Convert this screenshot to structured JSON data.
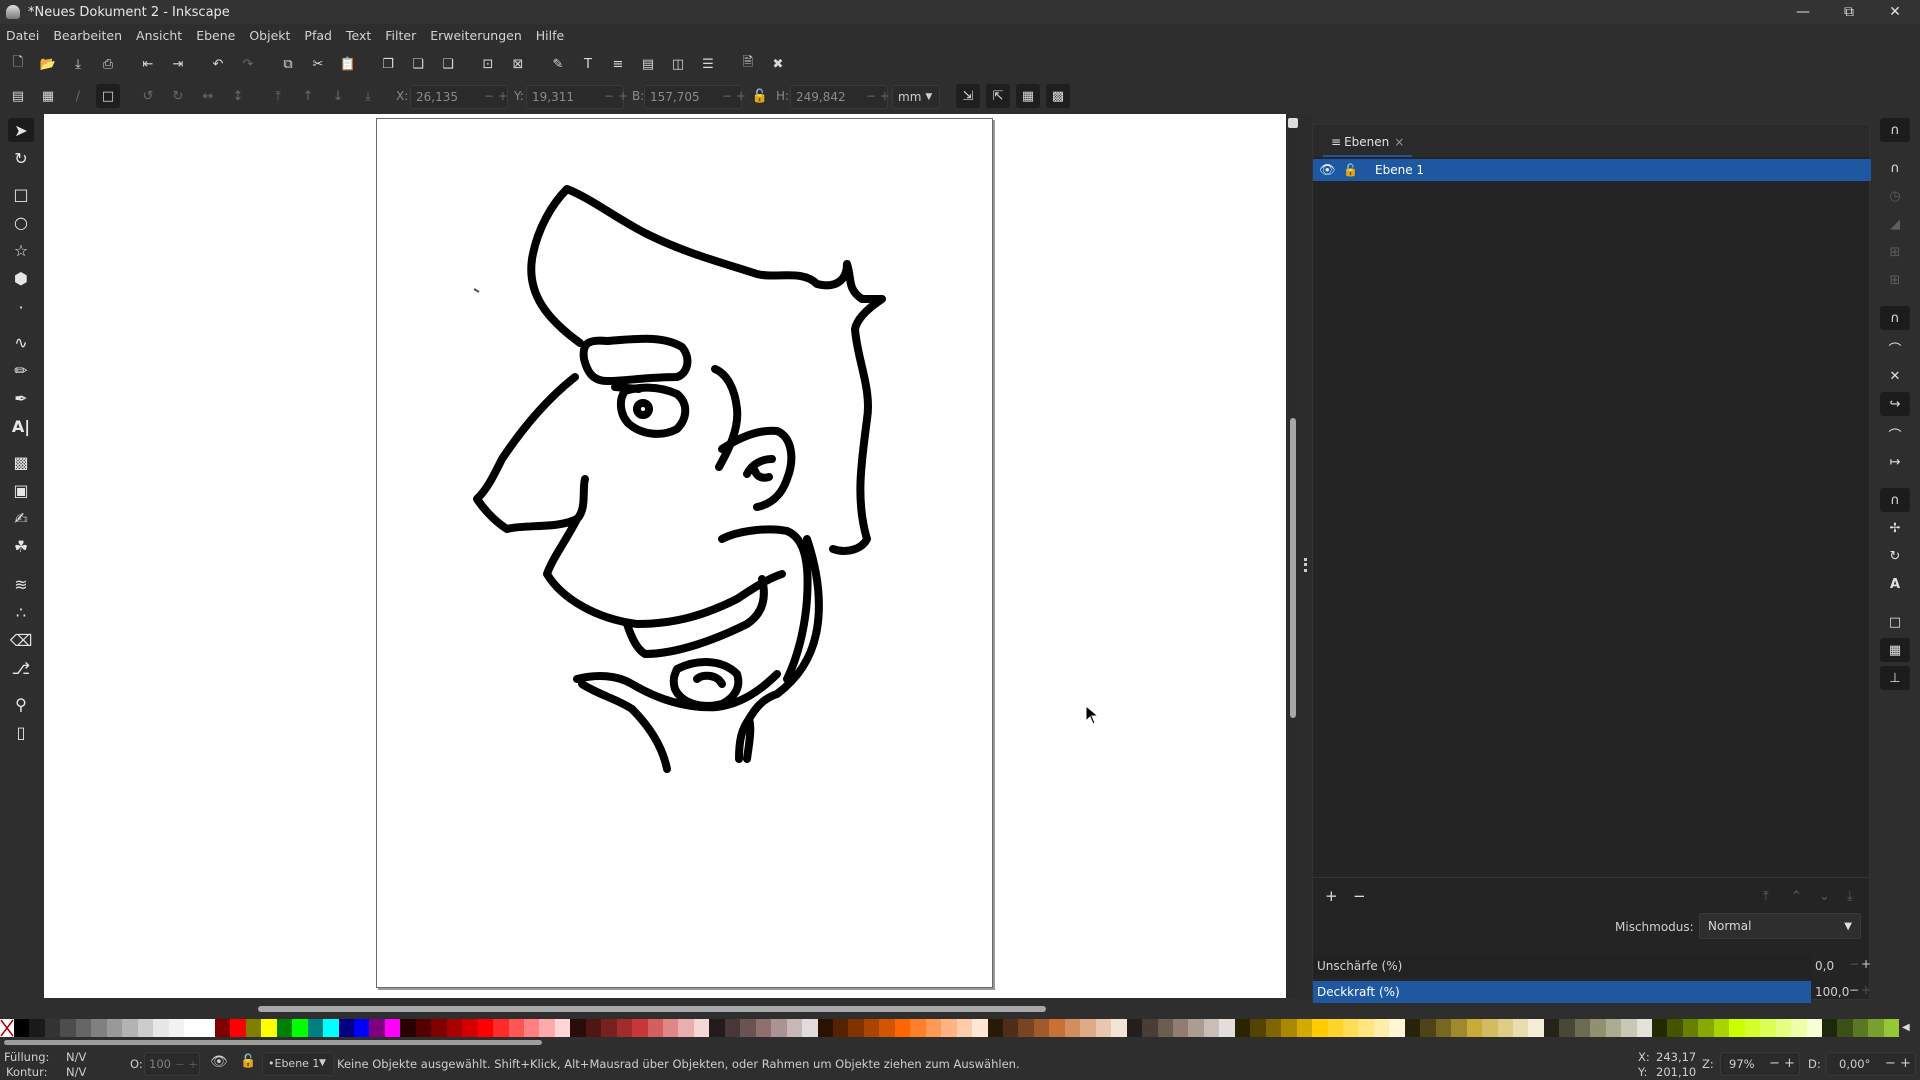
{
  "window": {
    "title": "*Neues Dokument 2 - Inkscape",
    "minimize_icon": "minimize-icon",
    "maximize_icon": "restore-icon",
    "close_icon": "close-icon"
  },
  "menu": [
    "Datei",
    "Bearbeiten",
    "Ansicht",
    "Ebene",
    "Objekt",
    "Pfad",
    "Text",
    "Filter",
    "Erweiterungen",
    "Hilfe"
  ],
  "commands_toolbar": [
    "new-document-icon",
    "open-icon",
    "save-icon",
    "print-icon",
    "import-icon",
    "export-icon",
    "undo-icon",
    "redo-icon",
    "copy-icon",
    "cut-icon",
    "paste-icon",
    "duplicate-icon",
    "clone-icon",
    "unlink-clone-icon",
    "group-icon",
    "ungroup-icon",
    "fill-stroke-icon",
    "text-font-icon",
    "layers-icon",
    "xml-editor-icon",
    "objects-icon",
    "align-distribute-icon",
    "document-properties-icon",
    "preferences-icon"
  ],
  "select_toolbar": {
    "icons": [
      "select-all-icon",
      "select-all-layers-icon",
      "deselect-icon",
      "touch-select-icon",
      "rotate-ccw-icon",
      "rotate-cw-icon",
      "flip-horizontal-icon",
      "flip-vertical-icon",
      "raise-to-top-icon",
      "raise-icon",
      "lower-icon",
      "lower-to-bottom-icon"
    ],
    "x_label": "X:",
    "x_value": "26,135",
    "y_label": "Y:",
    "y_value": "19,311",
    "w_label": "B:",
    "w_value": "157,705",
    "h_label": "H:",
    "h_value": "249,842",
    "lock_icon": "lock-open-icon",
    "unit": "mm",
    "transform_icons": [
      "scale-stroke-icon",
      "scale-corners-icon",
      "transform-gradients-icon",
      "transform-patterns-icon"
    ]
  },
  "toolbox": [
    "selector-tool",
    "node-tool",
    "rectangle-tool",
    "ellipse-tool",
    "star-tool",
    "3dbox-tool",
    "spiral-tool",
    "bezier-tool",
    "pencil-tool",
    "calligraphy-tool",
    "text-tool",
    "gradient-tool",
    "mesh-tool",
    "dropper-tool",
    "paint-bucket-tool",
    "tweak-tool",
    "spray-tool",
    "eraser-tool",
    "connector-tool",
    "zoom-tool",
    "measure-tool"
  ],
  "layers_panel": {
    "tab_label": "Ebenen",
    "layers": [
      {
        "name": "Ebene 1",
        "visible": true,
        "locked": false,
        "selected": true
      }
    ],
    "add_label": "+",
    "remove_label": "−",
    "blend_label": "Mischmodus:",
    "blend_value": "Normal",
    "blur_label": "Unschärfe (%)",
    "blur_value": "0,0",
    "opacity_label": "Deckkraft (%)",
    "opacity_value": "100,0"
  },
  "snap_bar": [
    "snap-toggle-icon",
    "snap-bbox-icon",
    "snap-bbox-edges-icon",
    "snap-bbox-corners-icon",
    "snap-bbox-midpoints-icon",
    "snap-bbox-centers-icon",
    "snap-nodes-icon",
    "snap-paths-icon",
    "snap-intersections-icon",
    "snap-cusp-nodes-icon",
    "snap-smooth-nodes-icon",
    "snap-midpoints-icon",
    "snap-others-icon",
    "snap-object-centers-icon",
    "snap-rotation-centers-icon",
    "snap-text-baseline-icon",
    "snap-page-border-icon",
    "snap-grid-icon",
    "snap-guide-icon"
  ],
  "palette": {
    "colors": [
      "#000000",
      "#1a1a1a",
      "#333333",
      "#4d4d4d",
      "#666666",
      "#808080",
      "#999999",
      "#b3b3b3",
      "#cccccc",
      "#e6e6e6",
      "#f2f2f2",
      "#ffffff",
      "#ffffff",
      "#800000",
      "#ff0000",
      "#808000",
      "#ffff00",
      "#008000",
      "#00ff00",
      "#008080",
      "#00ffff",
      "#000080",
      "#0000ff",
      "#800080",
      "#ff00ff",
      "#2b0000",
      "#550000",
      "#800000",
      "#aa0000",
      "#d40000",
      "#ff0000",
      "#ff2a2a",
      "#ff5555",
      "#ff8080",
      "#ffaaaa",
      "#ffd5d5",
      "#280b0b",
      "#501616",
      "#782121",
      "#a02c2c",
      "#c83737",
      "#d35f5f",
      "#de8787",
      "#e9afaf",
      "#f4d7d7",
      "#241c1c",
      "#483737",
      "#6c5353",
      "#916f6f",
      "#ac9393",
      "#c8b7b7",
      "#e3dbdb",
      "#2b1100",
      "#552200",
      "#803300",
      "#aa4400",
      "#d45500",
      "#ff6600",
      "#ff7f2a",
      "#ff9955",
      "#ffb380",
      "#ffccaa",
      "#ffe6d5",
      "#281a0b",
      "#502d16",
      "#784421",
      "#a05a2c",
      "#c87137",
      "#d38d5f",
      "#deaa87",
      "#e9c6af",
      "#f4e3d7",
      "#241f1c",
      "#483e37",
      "#6c5d53",
      "#917c6f",
      "#ac9d93",
      "#c8beb7",
      "#e3dedb",
      "#2b2200",
      "#554400",
      "#806600",
      "#aa8800",
      "#d4aa00",
      "#ffcc00",
      "#ffd42a",
      "#ffdd55",
      "#ffe680",
      "#ffeeaa",
      "#fff6d5",
      "#28220b",
      "#504416",
      "#786721",
      "#a0892c",
      "#c8ab37",
      "#d3bc5f",
      "#decd87",
      "#e9ddaf",
      "#f4eed7",
      "#24241c",
      "#484837",
      "#6c6c53",
      "#91916f",
      "#acac93",
      "#c8c8b7",
      "#e3e3db",
      "#222b00",
      "#445500",
      "#668000",
      "#88aa00",
      "#aad400",
      "#ccff00",
      "#d4ff2a",
      "#ddff55",
      "#e5ff80",
      "#eeffaa",
      "#f6ffd5",
      "#1e280b",
      "#3c5016",
      "#5a7821",
      "#77a02c",
      "#95c837"
    ]
  },
  "status": {
    "fill_label": "Füllung:",
    "fill_value": "N/V",
    "stroke_label": "Kontur:",
    "stroke_value": "N/V",
    "opacity_label": "O:",
    "opacity_value": "100",
    "layer_name": "•Ebene 1",
    "message": "Keine Objekte ausgewählt. Shift+Klick, Alt+Mausrad über Objekten, oder Rahmen um Objekte ziehen zum Auswählen.",
    "cursor_x_label": "X:",
    "cursor_x": "243,17",
    "cursor_y_label": "Y:",
    "cursor_y": "201,10",
    "zoom_label": "Z:",
    "zoom_value": "97%",
    "rotation_label": "D:",
    "rotation_value": "0,00°"
  },
  "canvas": {
    "drawing": "cartoon-face-profile"
  }
}
